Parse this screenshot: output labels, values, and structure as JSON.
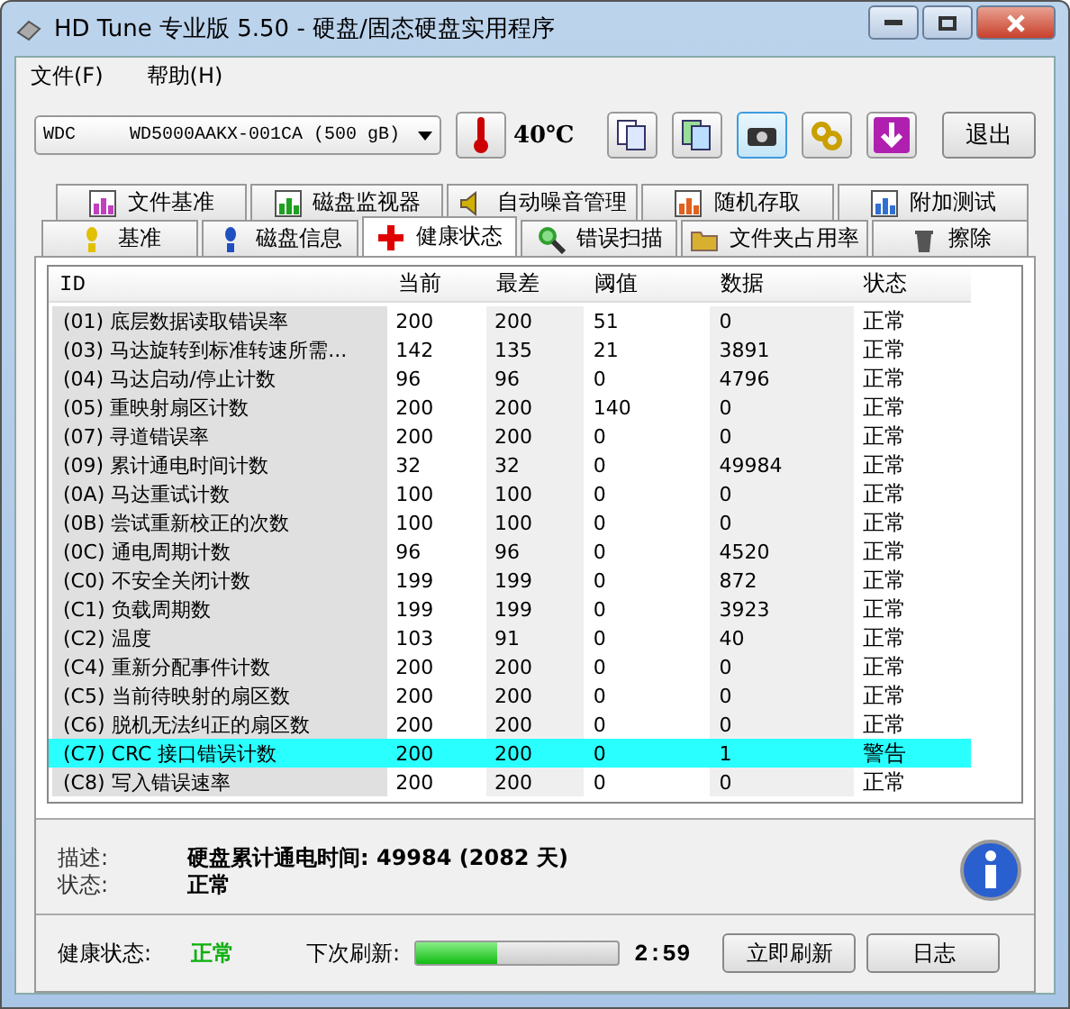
{
  "window": {
    "title": "HD Tune 专业版 5.50 - 硬盘/固态硬盘实用程序"
  },
  "menu": [
    "文件(F)",
    "帮助(H)"
  ],
  "toolbar": {
    "drive": "WDC     WD5000AAKX-001CA (500 gB)",
    "temperature": "40℃",
    "exit": "退出"
  },
  "tabs": [
    [
      {
        "label": "文件基准",
        "selected": false
      },
      {
        "label": "磁盘监视器",
        "selected": false
      },
      {
        "label": "自动噪音管理",
        "selected": false
      },
      {
        "label": "随机存取",
        "selected": false
      },
      {
        "label": "附加测试",
        "selected": false
      }
    ],
    [
      {
        "label": "基准",
        "selected": false
      },
      {
        "label": "磁盘信息",
        "selected": false
      },
      {
        "label": "健康状态",
        "selected": true
      },
      {
        "label": "错误扫描",
        "selected": false
      },
      {
        "label": "文件夹占用率",
        "selected": false
      },
      {
        "label": "擦除",
        "selected": false
      }
    ]
  ],
  "table": {
    "columns": [
      "ID",
      "当前",
      "最差",
      "阈值",
      "数据",
      "状态"
    ],
    "rows": [
      {
        "cells": [
          "(01) 底层数据读取错误率",
          "200",
          "200",
          "51",
          "0",
          "正常"
        ],
        "warning": false
      },
      {
        "cells": [
          "(03) 马达旋转到标准转速所需...",
          "142",
          "135",
          "21",
          "3891",
          "正常"
        ],
        "warning": false
      },
      {
        "cells": [
          "(04) 马达启动/停止计数",
          "96",
          "96",
          "0",
          "4796",
          "正常"
        ],
        "warning": false
      },
      {
        "cells": [
          "(05) 重映射扇区计数",
          "200",
          "200",
          "140",
          "0",
          "正常"
        ],
        "warning": false
      },
      {
        "cells": [
          "(07) 寻道错误率",
          "200",
          "200",
          "0",
          "0",
          "正常"
        ],
        "warning": false
      },
      {
        "cells": [
          "(09) 累计通电时间计数",
          "32",
          "32",
          "0",
          "49984",
          "正常"
        ],
        "warning": false
      },
      {
        "cells": [
          "(0A) 马达重试计数",
          "100",
          "100",
          "0",
          "0",
          "正常"
        ],
        "warning": false
      },
      {
        "cells": [
          "(0B) 尝试重新校正的次数",
          "100",
          "100",
          "0",
          "0",
          "正常"
        ],
        "warning": false
      },
      {
        "cells": [
          "(0C) 通电周期计数",
          "96",
          "96",
          "0",
          "4520",
          "正常"
        ],
        "warning": false
      },
      {
        "cells": [
          "(C0) 不安全关闭计数",
          "199",
          "199",
          "0",
          "872",
          "正常"
        ],
        "warning": false
      },
      {
        "cells": [
          "(C1) 负载周期数",
          "199",
          "199",
          "0",
          "3923",
          "正常"
        ],
        "warning": false
      },
      {
        "cells": [
          "(C2) 温度",
          "103",
          "91",
          "0",
          "40",
          "正常"
        ],
        "warning": false
      },
      {
        "cells": [
          "(C4) 重新分配事件计数",
          "200",
          "200",
          "0",
          "0",
          "正常"
        ],
        "warning": false
      },
      {
        "cells": [
          "(C5) 当前待映射的扇区数",
          "200",
          "200",
          "0",
          "0",
          "正常"
        ],
        "warning": false
      },
      {
        "cells": [
          "(C6) 脱机无法纠正的扇区数",
          "200",
          "200",
          "0",
          "0",
          "正常"
        ],
        "warning": false
      },
      {
        "cells": [
          "(C7) CRC 接口错误计数",
          "200",
          "200",
          "0",
          "1",
          "警告"
        ],
        "warning": true
      },
      {
        "cells": [
          "(C8) 写入错误速率",
          "200",
          "200",
          "0",
          "0",
          "正常"
        ],
        "warning": false
      }
    ]
  },
  "details": [
    {
      "label": "描述:",
      "value": "硬盘累计通电时间: 49984 (2082 天)"
    },
    {
      "label": "状态:",
      "value": "正常"
    }
  ],
  "footer": {
    "health_label": "健康状态:",
    "health": "正常",
    "refresh_label": "下次刷新:",
    "progress": {
      "level": 0.4
    },
    "countdown": "2:59",
    "buttons": [
      "立即刷新",
      "日志"
    ]
  }
}
